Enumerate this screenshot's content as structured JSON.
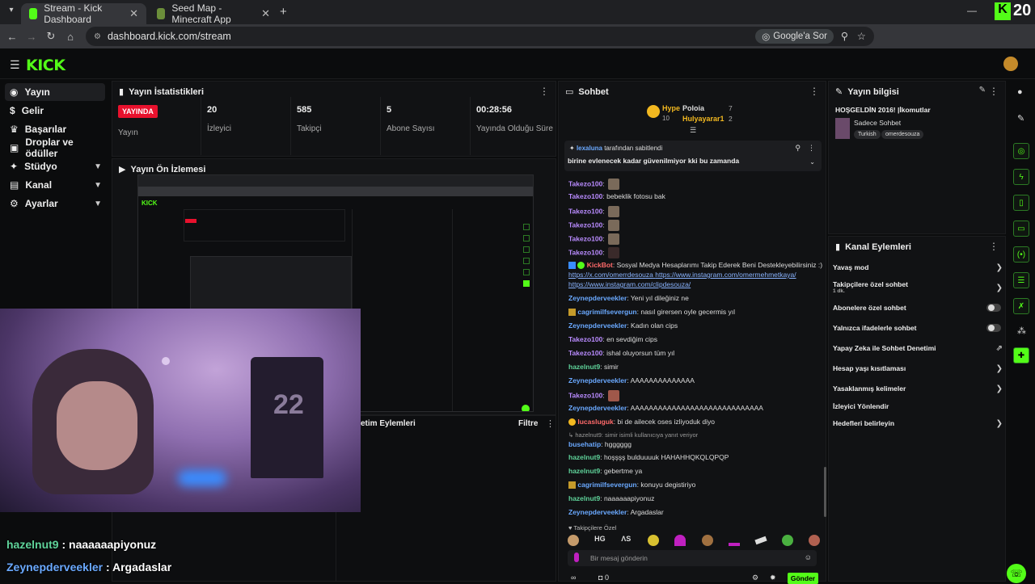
{
  "browser": {
    "tabs": [
      {
        "title": "Stream - Kick Dashboard",
        "active": true,
        "icon": "kick-icon"
      },
      {
        "title": "Seed Map - Minecraft App",
        "active": false,
        "icon": "minecraft-icon"
      }
    ],
    "url": "dashboard.kick.com/stream",
    "ask_label": "Google'a Sor",
    "corner_number": "20"
  },
  "kick": {
    "logo": "KICK",
    "accent": "#53fc18"
  },
  "sidebar": {
    "items": [
      {
        "label": "Yayın",
        "icon": "broadcast-icon",
        "active": true,
        "expandable": false
      },
      {
        "label": "Gelir",
        "icon": "dollar-icon",
        "active": false,
        "expandable": false
      },
      {
        "label": "Başarılar",
        "icon": "trophy-icon",
        "active": false,
        "expandable": false
      },
      {
        "label": "Droplar ve ödüller",
        "icon": "gift-icon",
        "active": false,
        "expandable": false
      },
      {
        "label": "Stüdyo",
        "icon": "studio-icon",
        "active": false,
        "expandable": true
      },
      {
        "label": "Kanal",
        "icon": "channel-icon",
        "active": false,
        "expandable": true
      },
      {
        "label": "Ayarlar",
        "icon": "gear-icon",
        "active": false,
        "expandable": true
      }
    ]
  },
  "stats_panel": {
    "title": "Yayın İstatistikleri",
    "stats": [
      {
        "value": "YAYINDA",
        "label": "Yayın"
      },
      {
        "value": "20",
        "label": "İzleyici"
      },
      {
        "value": "585",
        "label": "Takipçi"
      },
      {
        "value": "5",
        "label": "Abone Sayısı"
      },
      {
        "value": "00:28:56",
        "label": "Yayında Olduğu Süre"
      }
    ]
  },
  "preview_panel": {
    "title": "Yayın Ön İzlemesi"
  },
  "actions_panel": {
    "title_fragment": "etim Eylemleri",
    "filter_label": "Filtre"
  },
  "chat": {
    "title": "Sohbet",
    "leaderboard": [
      {
        "label": "Hype"
      },
      {
        "label": "10"
      },
      {
        "label": "Poloia"
      },
      {
        "label": "Hulyayarar1"
      },
      {
        "label": "7"
      },
      {
        "label": "2"
      }
    ],
    "pinned": {
      "by_user": "lexaluna",
      "by_suffix": "tarafından sabitlendi",
      "message": "birine evlenecek kadar güvenilmiyor kki bu zamanda"
    },
    "messages": [
      {
        "user": "Takezo100",
        "text": "",
        "color": "#b98bff",
        "emote": true
      },
      {
        "user": "Takezo100",
        "text": "bebeklik fotosu bak",
        "color": "#b98bff",
        "emote": false
      },
      {
        "user": "Takezo100",
        "text": "",
        "color": "#b98bff",
        "emote": true
      },
      {
        "user": "Takezo100",
        "text": "",
        "color": "#b98bff",
        "emote": true
      },
      {
        "user": "Takezo100",
        "text": "",
        "color": "#b98bff",
        "emote": true
      },
      {
        "user": "Takezo100",
        "text": "",
        "color": "#b98bff",
        "emote": true
      }
    ],
    "bot_message": {
      "user": "KickBot",
      "text": "Sosyal Medya Hesaplarımı Takip Ederek Beni Destekleyebilirsiniz :)",
      "link1": "https://x.com/omerrdesouza",
      "link2": "https://www.instagram.com/omermehmetkaya/",
      "link3": "https://www.instagram.com/clipdesouza/"
    },
    "messages2": [
      {
        "user": "Zeynepderveekler",
        "text": "Yeni yıl dileğiniz ne",
        "color": "#6aa9ff"
      },
      {
        "user": "cagrimilfsevergun",
        "text": "nasıl girersen oyle gecermis yıl",
        "color": "#6aa9ff"
      },
      {
        "user": "Zeynepderveekler",
        "text": "Kadın olan cips",
        "color": "#6aa9ff"
      },
      {
        "user": "Takezo100",
        "text": "en sevdiğim cips",
        "color": "#b98bff"
      },
      {
        "user": "Takezo100",
        "text": "ishal oluyorsun tüm yıl",
        "color": "#b98bff"
      },
      {
        "user": "hazelnut9",
        "text": "simir",
        "color": "#5fd39a"
      },
      {
        "user": "Zeynepderveekler",
        "text": "AAAAAAAAAAAAAA",
        "color": "#6aa9ff"
      },
      {
        "user": "Takezo100",
        "text": "",
        "color": "#b98bff"
      },
      {
        "user": "Zeynepderveekler",
        "text": "AAAAAAAAAAAAAAAAAAAAAAAAAAAAA",
        "color": "#6aa9ff"
      },
      {
        "user": "lucasluguk",
        "text": "bi de ailecek oses izliyoduk diyo",
        "color": "#ff6a6a"
      }
    ],
    "reply_note": "hazelnut9: simir isimli kullanıcıya yanıt veriyor",
    "messages3": [
      {
        "user": "busehatip",
        "text": "hgggggg",
        "color": "#6aa9ff"
      },
      {
        "user": "hazelnut9",
        "text": "hoşşşş bulduuuuk HAHAHHQKQLQPQP",
        "color": "#5fd39a"
      },
      {
        "user": "hazelnut9",
        "text": "gebertme ya",
        "color": "#5fd39a"
      },
      {
        "user": "cagrimilfsevergun",
        "text": "konuyu degistiriyo",
        "color": "#6aa9ff"
      },
      {
        "user": "hazelnut9",
        "text": "naaaaaapiyonuz",
        "color": "#5fd39a"
      },
      {
        "user": "Zeynepderveekler",
        "text": "Argadaslar",
        "color": "#6aa9ff"
      }
    ],
    "followers_only_label": "Takipçilere Özel",
    "input_placeholder": "Bir mesaj gönderin",
    "send_label": "Gönder",
    "bottom_count": "0"
  },
  "stream_info": {
    "title": "Yayın bilgisi",
    "stream_title": "HOŞGELDİN 2016! |İkomutlar",
    "category": "Sadece Sohbet",
    "tags": [
      "Turkish",
      "omerdesouza"
    ]
  },
  "channel_actions": {
    "title": "Kanal Eylemleri",
    "items": [
      {
        "label": "Yavaş mod",
        "sub": "",
        "control": "arrow"
      },
      {
        "label": "Takipçilere özel sohbet",
        "sub": "1 dk.",
        "control": "arrow"
      },
      {
        "label": "Abonelere özel sohbet",
        "sub": "",
        "control": "toggle"
      },
      {
        "label": "Yalnızca ifadelerle sohbet",
        "sub": "",
        "control": "toggle"
      },
      {
        "label": "Yapay Zeka ile Sohbet Denetimi",
        "sub": "",
        "control": "external"
      },
      {
        "label": "Hesap yaşı kısıtlaması",
        "sub": "",
        "control": "arrow"
      },
      {
        "label": "Yasaklanmış kelimeler",
        "sub": "",
        "control": "arrow"
      },
      {
        "label": "İzleyici Yönlendir",
        "sub": "",
        "control": "none"
      },
      {
        "label": "Hedefleri belirleyin",
        "sub": "",
        "control": "arrow"
      }
    ]
  },
  "overlay_chat": [
    {
      "user": "hazelnut9",
      "text": " : naaaaaapiyonuz",
      "color": "#5fd39a"
    },
    {
      "user": "Zeynepderveekler",
      "text": " : Argadaslar",
      "color": "#6aa9ff"
    }
  ]
}
